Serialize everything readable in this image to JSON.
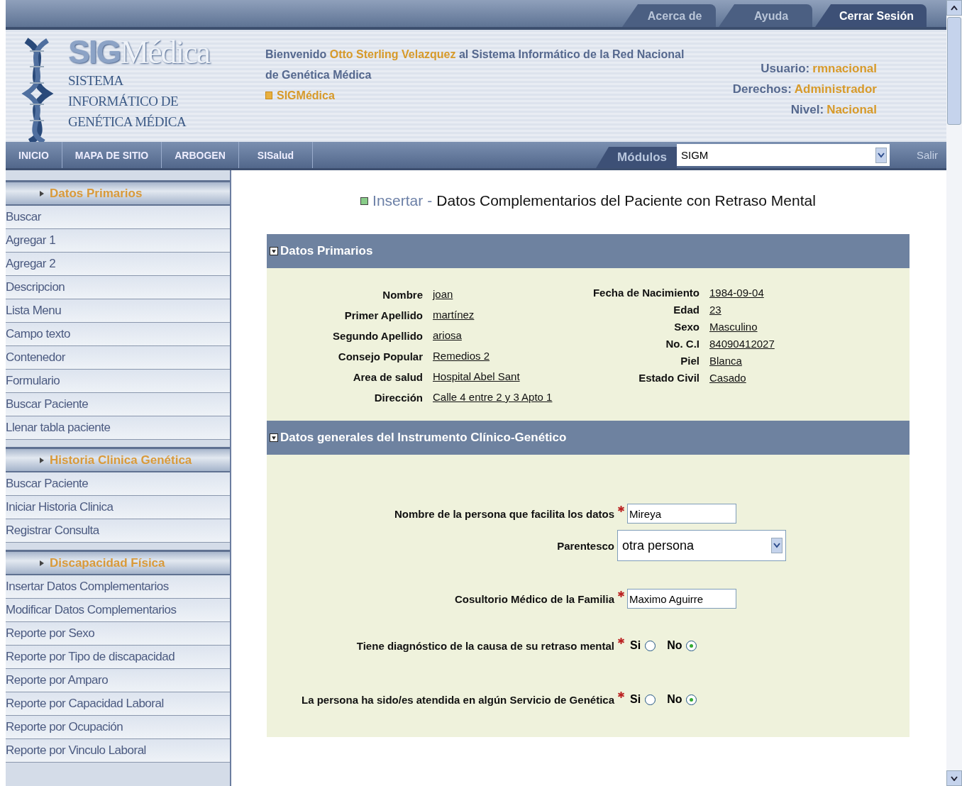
{
  "top_tabs": [
    {
      "label": "Acerca de",
      "selected": false
    },
    {
      "label": "Ayuda",
      "selected": false
    },
    {
      "label": "Cerrar Sesión",
      "selected": true
    }
  ],
  "logo": {
    "title_a": "SIG",
    "title_b": "Médica",
    "subtitle": "SISTEMA INFORMÁTICO DE GENÉTICA MÉDICA"
  },
  "welcome": {
    "text": "Bienvenido **Otto Sterling Velazquez** al Sistema Informático de la Red Nacional de Genética Médica",
    "link": "SIGMédica"
  },
  "user_info": [
    {
      "label": "Usuario:",
      "value": "rmnacional"
    },
    {
      "label": "Derechos:",
      "value": "Administrador"
    },
    {
      "label": "Nivel:",
      "value": "Nacional"
    }
  ],
  "nav": [
    "INICIO",
    "MAPA DE SITIO",
    "ARBOGEN",
    "SISalud"
  ],
  "modules": {
    "label": "Módulos",
    "value": "SIGM",
    "exit": "Salir"
  },
  "sidebar": [
    {
      "title": "Datos Primarios",
      "items": [
        "Buscar",
        "Agregar 1",
        "Agregar 2",
        "Descripcion",
        "Lista Menu",
        "Campo texto",
        "Contenedor",
        "Formulario",
        "Buscar Paciente",
        "Llenar tabla paciente"
      ]
    },
    {
      "title": "Historia Clinica Genética",
      "items": [
        "Buscar Paciente",
        "Iniciar Historia Clinica",
        "Registrar Consulta"
      ]
    },
    {
      "title": "Discapacidad Física",
      "items": [
        "Insertar Datos Complementarios",
        "Modificar Datos Complementarios",
        "Reporte por Sexo",
        "Reporte por Tipo de discapacidad",
        "Reporte por Amparo",
        "Reporte por Capacidad Laboral",
        "Reporte por Ocupación",
        "Reporte por Vinculo Laboral"
      ]
    }
  ],
  "page_title": {
    "action": "Insertar",
    "separator": "-",
    "text": "Datos Complementarios del Paciente con Retraso Mental"
  },
  "primary_section": {
    "title": "Datos Primarios",
    "expanded": true,
    "left": [
      {
        "label": "Nombre",
        "value": "joan"
      },
      {
        "label": "Primer Apellido",
        "value": "martínez"
      },
      {
        "label": "Segundo Apellido",
        "value": "ariosa"
      },
      {
        "label": "Consejo Popular",
        "value": "Remedios 2"
      },
      {
        "label": "Area de salud",
        "value": "Hospital Abel Sant"
      },
      {
        "label": "Dirección",
        "value": "Calle 4 entre 2 y 3 Apto 1"
      }
    ],
    "right": [
      {
        "label": "Fecha de Nacimiento",
        "value": "1984-09-04"
      },
      {
        "label": "Edad",
        "value": "23"
      },
      {
        "label": "Sexo",
        "value": "Masculino"
      },
      {
        "label": "No. C.I",
        "value": "84090412027"
      },
      {
        "label": "Piel",
        "value": "Blanca"
      },
      {
        "label": "Estado Civil",
        "value": "Casado"
      }
    ]
  },
  "general_section": {
    "title": "Datos generales del Instrumento Clínico-Genético",
    "expanded": true,
    "fields": [
      {
        "kind": "text",
        "label": "Nombre de la persona que facilita los datos",
        "required": true,
        "value": "Mireya"
      },
      {
        "kind": "select",
        "label": "Parentesco",
        "required": false,
        "value": "otra persona"
      },
      {
        "kind": "text",
        "label": "Cosultorio Médico de la Familia",
        "required": true,
        "value": "Maximo Aguirre"
      },
      {
        "kind": "radio",
        "label": "Tiene diagnóstico de la causa de su retraso mental",
        "required": true,
        "options": [
          {
            "label": "Si",
            "selected": false
          },
          {
            "label": "No",
            "selected": true
          }
        ]
      },
      {
        "kind": "radio",
        "label": "La persona ha sido/es atendida en algún Servicio de Genética",
        "required": true,
        "options": [
          {
            "label": "Si",
            "selected": false
          },
          {
            "label": "No",
            "selected": true
          }
        ]
      }
    ]
  }
}
